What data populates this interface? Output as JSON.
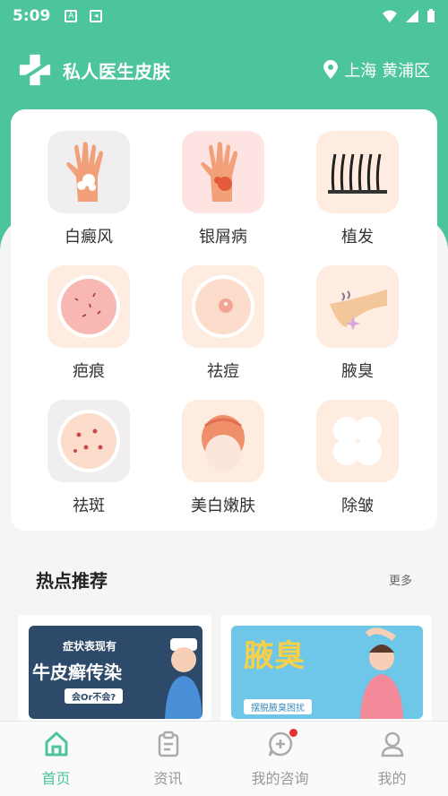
{
  "status_bar": {
    "time": "5:09"
  },
  "header": {
    "title": "私人医生皮肤",
    "location": "上海 黄浦区"
  },
  "services": [
    {
      "label": "白癜风",
      "icon": "hand-vitiligo-icon"
    },
    {
      "label": "银屑病",
      "icon": "hand-psoriasis-icon"
    },
    {
      "label": "植发",
      "icon": "hair-icon"
    },
    {
      "label": "疤痕",
      "icon": "scar-icon"
    },
    {
      "label": "祛痘",
      "icon": "acne-icon"
    },
    {
      "label": "腋臭",
      "icon": "armpit-icon"
    },
    {
      "label": "祛斑",
      "icon": "spots-icon"
    },
    {
      "label": "美白嫩肤",
      "icon": "face-whitening-icon"
    },
    {
      "label": "除皱",
      "icon": "wrinkle-icon"
    }
  ],
  "hot": {
    "title": "热点推荐",
    "more": "更多",
    "cards": [
      {
        "line1": "症状表现有",
        "line2": "牛皮癣传染",
        "line3": "会Or不会?"
      },
      {
        "title": "腋臭",
        "subtitle": "摆脱腋臭困扰"
      }
    ]
  },
  "nav": {
    "items": [
      {
        "label": "首页",
        "icon": "home-icon",
        "active": true
      },
      {
        "label": "资讯",
        "icon": "clipboard-icon",
        "active": false
      },
      {
        "label": "我的咨询",
        "icon": "chat-add-icon",
        "active": false
      },
      {
        "label": "我的",
        "icon": "user-icon",
        "active": false
      }
    ]
  },
  "colors": {
    "brand": "#4cc49c",
    "tile_bg": "#fdecdf",
    "badge": "#e63030"
  }
}
